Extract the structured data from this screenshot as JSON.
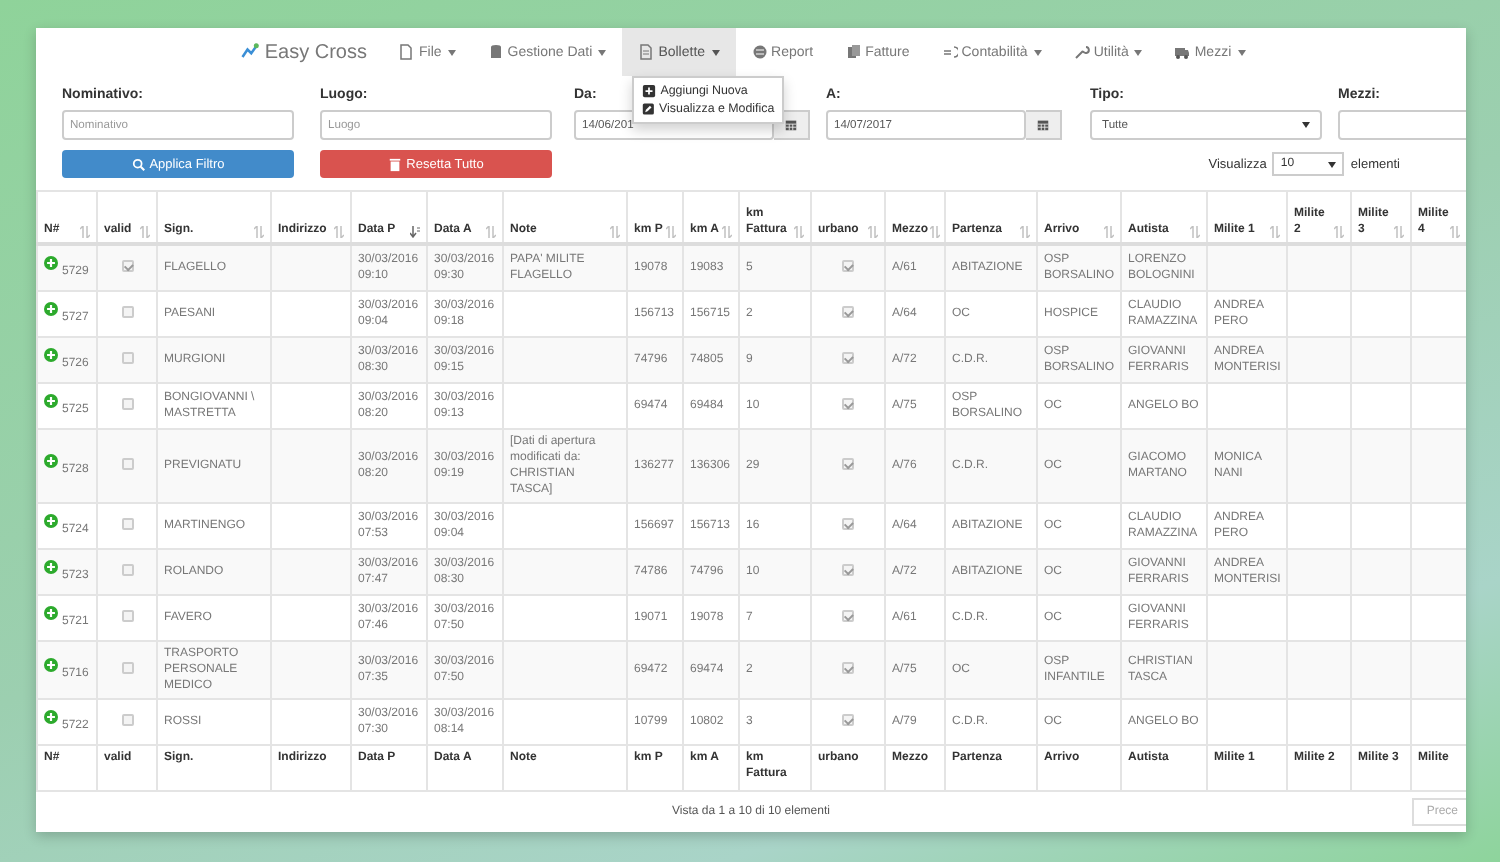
{
  "navbar": {
    "brand": "Easy Cross",
    "items": [
      {
        "label": "File",
        "dropdown": true,
        "selected": false
      },
      {
        "label": "Gestione Dati",
        "dropdown": true,
        "selected": false
      },
      {
        "label": "Bollette",
        "dropdown": true,
        "selected": true
      },
      {
        "label": "Report",
        "dropdown": false,
        "selected": false
      },
      {
        "label": "Fatture",
        "dropdown": false,
        "selected": false
      },
      {
        "label": "Contabilità",
        "dropdown": true,
        "selected": false
      },
      {
        "label": "Utilità",
        "dropdown": true,
        "selected": false
      },
      {
        "label": "Mezzi",
        "dropdown": true,
        "selected": false
      }
    ]
  },
  "menu": {
    "items": [
      "Aggiungi Nuova",
      "Visualizza e Modifica"
    ]
  },
  "filters": [
    {
      "label": "Nominativo:",
      "kind": "text",
      "placeholder": "Nominativo"
    },
    {
      "label": "Luogo:",
      "kind": "text",
      "placeholder": "Luogo"
    },
    {
      "label": "Da:",
      "kind": "date",
      "value": "14/06/201"
    },
    {
      "label": "A:",
      "kind": "date",
      "value": "14/07/2017"
    },
    {
      "label": "Tipo:",
      "kind": "select",
      "value": "Tutte"
    },
    {
      "label": "Mezzi:",
      "kind": "text"
    }
  ],
  "buttons": [
    {
      "label": "Applica Filtro",
      "kind": "primary"
    },
    {
      "label": "Resetta Tutto",
      "kind": "danger"
    }
  ],
  "page_size": {
    "label": "Visualizza",
    "value": "10",
    "suffix": "elementi"
  },
  "table": {
    "columns": [
      {
        "label": "N#",
        "sorted": false
      },
      {
        "label": "valid",
        "sorted": false
      },
      {
        "label": "Sign.",
        "sorted": false
      },
      {
        "label": "Indirizzo",
        "sorted": false
      },
      {
        "label": "Data P",
        "sorted": true
      },
      {
        "label": "Data A",
        "sorted": false
      },
      {
        "label": "Note",
        "sorted": false
      },
      {
        "label": "km P",
        "sorted": false
      },
      {
        "label": "km A",
        "sorted": false
      },
      {
        "label": "km Fattura",
        "sorted": false
      },
      {
        "label": "urbano",
        "sorted": false
      },
      {
        "label": "Mezzo",
        "sorted": false
      },
      {
        "label": "Partenza",
        "sorted": false
      },
      {
        "label": "Arrivo",
        "sorted": false
      },
      {
        "label": "Autista",
        "sorted": false
      },
      {
        "label": "Milite 1",
        "sorted": false
      },
      {
        "label": "Milite 2",
        "sorted": false
      },
      {
        "label": "Milite 3",
        "sorted": false
      },
      {
        "label": "Milite 4",
        "sorted": false
      }
    ],
    "rows": [
      {
        "number": "5729",
        "valid": true,
        "sign": "FLAGELLO",
        "data_p": "30/03/2016 09:10",
        "data_a": "30/03/2016 09:30",
        "note": "PAPA' MILITE FLAGELLO",
        "km_p": "19078",
        "km_a": "19083",
        "km_fattura": "5",
        "urbano": true,
        "mezzo": "A/61",
        "partenza": "ABITAZIONE",
        "arrivo": "OSP BORSALINO",
        "autista": "LORENZO BOLOGNINI"
      },
      {
        "number": "5727",
        "valid": false,
        "sign": "PAESANI",
        "data_p": "30/03/2016 09:04",
        "data_a": "30/03/2016 09:18",
        "km_p": "156713",
        "km_a": "156715",
        "km_fattura": "2",
        "urbano": true,
        "mezzo": "A/64",
        "partenza": "OC",
        "arrivo": "HOSPICE",
        "autista": "CLAUDIO RAMAZZINA",
        "milite_1": "ANDREA PERO"
      },
      {
        "number": "5726",
        "valid": false,
        "sign": "MURGIONI",
        "data_p": "30/03/2016 08:30",
        "data_a": "30/03/2016 09:15",
        "km_p": "74796",
        "km_a": "74805",
        "km_fattura": "9",
        "urbano": true,
        "mezzo": "A/72",
        "partenza": "C.D.R.",
        "arrivo": "OSP BORSALINO",
        "autista": "GIOVANNI FERRARIS",
        "milite_1": "ANDREA MONTERISI"
      },
      {
        "number": "5725",
        "valid": false,
        "sign": "BONGIOVANNI \\ MASTRETTA",
        "data_p": "30/03/2016 08:20",
        "data_a": "30/03/2016 09:13",
        "km_p": "69474",
        "km_a": "69484",
        "km_fattura": "10",
        "urbano": true,
        "mezzo": "A/75",
        "partenza": "OSP BORSALINO",
        "arrivo": "OC",
        "autista": "ANGELO BO"
      },
      {
        "number": "5728",
        "valid": false,
        "sign": "PREVIGNATU",
        "data_p": "30/03/2016 08:20",
        "data_a": "30/03/2016 09:19",
        "note": "[Dati di apertura modificati da: CHRISTIAN TASCA]",
        "km_p": "136277",
        "km_a": "136306",
        "km_fattura": "29",
        "urbano": true,
        "mezzo": "A/76",
        "partenza": "C.D.R.",
        "arrivo": "OC",
        "autista": "GIACOMO MARTANO",
        "milite_1": "MONICA NANI"
      },
      {
        "number": "5724",
        "valid": false,
        "sign": "MARTINENGO",
        "data_p": "30/03/2016 07:53",
        "data_a": "30/03/2016 09:04",
        "km_p": "156697",
        "km_a": "156713",
        "km_fattura": "16",
        "urbano": true,
        "mezzo": "A/64",
        "partenza": "ABITAZIONE",
        "arrivo": "OC",
        "autista": "CLAUDIO RAMAZZINA",
        "milite_1": "ANDREA PERO"
      },
      {
        "number": "5723",
        "valid": false,
        "sign": "ROLANDO",
        "data_p": "30/03/2016 07:47",
        "data_a": "30/03/2016 08:30",
        "km_p": "74786",
        "km_a": "74796",
        "km_fattura": "10",
        "urbano": true,
        "mezzo": "A/72",
        "partenza": "ABITAZIONE",
        "arrivo": "OC",
        "autista": "GIOVANNI FERRARIS",
        "milite_1": "ANDREA MONTERISI"
      },
      {
        "number": "5721",
        "valid": false,
        "sign": "FAVERO",
        "data_p": "30/03/2016 07:46",
        "data_a": "30/03/2016 07:50",
        "km_p": "19071",
        "km_a": "19078",
        "km_fattura": "7",
        "urbano": true,
        "mezzo": "A/61",
        "partenza": "C.D.R.",
        "arrivo": "OC",
        "autista": "GIOVANNI FERRARIS"
      },
      {
        "number": "5716",
        "valid": false,
        "sign": "TRASPORTO PERSONALE MEDICO",
        "data_p": "30/03/2016 07:35",
        "data_a": "30/03/2016 07:50",
        "km_p": "69472",
        "km_a": "69474",
        "km_fattura": "2",
        "urbano": true,
        "mezzo": "A/75",
        "partenza": "OC",
        "arrivo": "OSP INFANTILE",
        "autista": "CHRISTIAN TASCA"
      },
      {
        "number": "5722",
        "valid": false,
        "sign": "ROSSI",
        "data_p": "30/03/2016 07:30",
        "data_a": "30/03/2016 08:14",
        "km_p": "10799",
        "km_a": "10802",
        "km_fattura": "3",
        "urbano": true,
        "mezzo": "A/79",
        "partenza": "C.D.R.",
        "arrivo": "OC",
        "autista": "ANGELO BO"
      }
    ],
    "footer": [
      "N#",
      "valid",
      "Sign.",
      "Indirizzo",
      "Data P",
      "Data A",
      "Note",
      "km P",
      "km A",
      "km Fattura",
      "urbano",
      "Mezzo",
      "Partenza",
      "Arrivo",
      "Autista",
      "Milite 1",
      "Milite 2",
      "Milite 3",
      "Milite"
    ]
  },
  "info": "Vista da 1 a 10 di 10 elementi",
  "pager": {
    "label": "Prece"
  }
}
